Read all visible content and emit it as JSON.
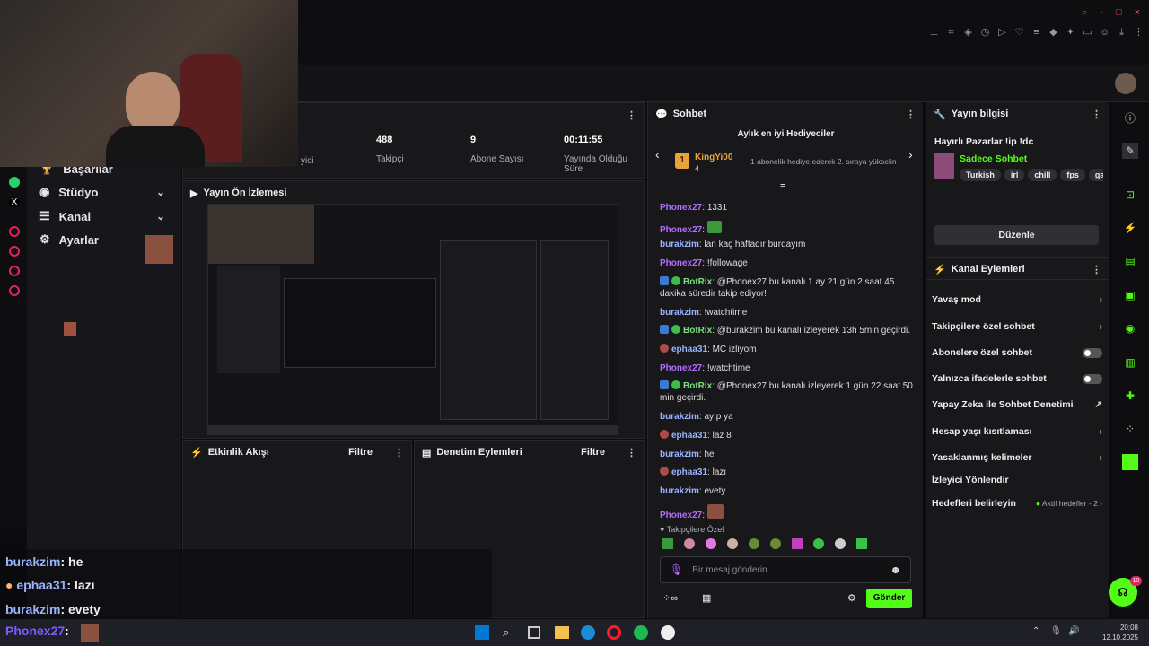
{
  "header": {
    "window_controls": [
      "-",
      "□",
      "×"
    ]
  },
  "sidebar": {
    "items": [
      {
        "label": "Başarılar"
      },
      {
        "label": "Stüdyo"
      },
      {
        "label": "Kanal"
      },
      {
        "label": "Ayarlar"
      }
    ]
  },
  "stats": [
    {
      "value": "",
      "label": "yici"
    },
    {
      "value": "488",
      "label": "Takipçi"
    },
    {
      "value": "9",
      "label": "Abone Sayısı"
    },
    {
      "value": "00:11:55",
      "label": "Yayında Olduğu Süre"
    }
  ],
  "preview": {
    "title": "Yayın Ön İzlemesi"
  },
  "activity": {
    "title": "Etkinlik Akışı",
    "filter": "Filtre"
  },
  "moderation": {
    "title": "Denetim Eylemleri",
    "filter": "Filtre"
  },
  "chat": {
    "title": "Sohbet",
    "top_gifters_title": "Aylık en iyi Hediyeciler",
    "top_gifter": {
      "rank": "1",
      "name": "KingYi00",
      "count": "4",
      "text": "1 abonelik hediye ederek 2. sıraya yükselin"
    },
    "messages": [
      {
        "user": "Phonex27",
        "color": "purple",
        "text": "1331"
      },
      {
        "user": "Phonex27",
        "color": "purple",
        "text": ""
      },
      {
        "user": "burakzim",
        "color": "blue",
        "text": "lan kaç haftadır burdayım"
      },
      {
        "user": "Phonex27",
        "color": "purple",
        "text": "!followage"
      },
      {
        "user": "BotRix",
        "color": "green",
        "text": "@Phonex27 bu kanalı 1 ay 21 gün 2 saat 45 dakika süredir takip ediyor!"
      },
      {
        "user": "burakzim",
        "color": "blue",
        "text": "!watchtime"
      },
      {
        "user": "BotRix",
        "color": "green",
        "text": "@burakzim bu kanalı izleyerek 13h 5min geçirdi."
      },
      {
        "user": "ephaa31",
        "color": "blue",
        "text": "MC izliyom"
      },
      {
        "user": "Phonex27",
        "color": "purple",
        "text": "!watchtime"
      },
      {
        "user": "BotRix",
        "color": "green",
        "text": "@Phonex27 bu kanalı izleyerek 1 gün 22 saat 50 min geçirdi."
      },
      {
        "user": "burakzim",
        "color": "blue",
        "text": "ayıp ya"
      },
      {
        "user": "ephaa31",
        "color": "blue",
        "text": "laz 8"
      },
      {
        "user": "burakzim",
        "color": "blue",
        "text": "he"
      },
      {
        "user": "ephaa31",
        "color": "blue",
        "text": "lazı"
      },
      {
        "user": "burakzim",
        "color": "blue",
        "text": "evety"
      },
      {
        "user": "Phonex27",
        "color": "purple",
        "text": ""
      }
    ],
    "followers_only": "Takipçilere Özel",
    "input_placeholder": "Bir mesaj gönderin",
    "send_label": "Gönder"
  },
  "stream_info": {
    "title": "Yayın bilgisi",
    "stream_title": "Hayırlı Pazarlar !ip !dc",
    "category": "Sadece Sohbet",
    "tags": [
      "Turkish",
      "irl",
      "chill",
      "fps",
      "gamir"
    ],
    "edit_label": "Düzenle"
  },
  "channel_actions": {
    "title": "Kanal Eylemleri",
    "items": [
      {
        "label": "Yavaş mod"
      },
      {
        "label": "Takipçilere özel sohbet"
      },
      {
        "label": "Abonelere özel sohbet"
      },
      {
        "label": "Yalnızca ifadelerle sohbet"
      },
      {
        "label": "Yapay Zeka ile Sohbet Denetimi"
      },
      {
        "label": "Hesap yaşı kısıtlaması"
      },
      {
        "label": "Yasaklanmış kelimeler"
      },
      {
        "label": "İzleyici Yönlendir"
      },
      {
        "label": "Hedefleri belirleyin"
      }
    ],
    "active_goals": "Aktif hedefler - 2"
  },
  "overlay_chat": [
    {
      "user": "burakzim",
      "text": ": he"
    },
    {
      "user": "ephaa31",
      "text": ": lazı"
    },
    {
      "user": "burakzim",
      "text": ": evety"
    },
    {
      "user": "Phonex27",
      "text": ":"
    }
  ],
  "taskbar": {
    "time": "20:08",
    "date": "12.10.2025"
  },
  "notification_count": "10"
}
